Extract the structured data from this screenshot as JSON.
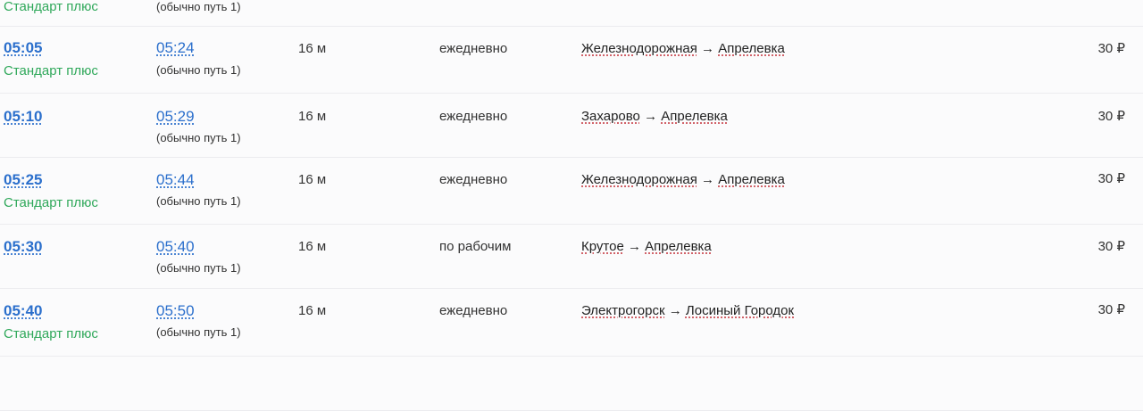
{
  "rows": [
    {
      "departure": "",
      "arrival": "",
      "type": "Стандарт плюс",
      "track": "(обычно путь 1)",
      "duration": "",
      "days": "",
      "from": "",
      "to": "",
      "arrow": "",
      "price": ""
    },
    {
      "departure": "05:05",
      "arrival": "05:24",
      "type": "Стандарт плюс",
      "track": "(обычно путь 1)",
      "duration": "16 м",
      "days": "ежедневно",
      "from": "Железнодорожная",
      "arrow": "→",
      "to": "Апрелевка",
      "price": "30 ₽"
    },
    {
      "departure": "05:10",
      "arrival": "05:29",
      "type": "",
      "track": "(обычно путь 1)",
      "duration": "16 м",
      "days": "ежедневно",
      "from": "Захарово",
      "arrow": "→",
      "to": "Апрелевка",
      "price": "30 ₽"
    },
    {
      "departure": "05:25",
      "arrival": "05:44",
      "type": "Стандарт плюс",
      "track": "(обычно путь 1)",
      "duration": "16 м",
      "days": "ежедневно",
      "from": "Железнодорожная",
      "arrow": "→",
      "to": "Апрелевка",
      "price": "30 ₽"
    },
    {
      "departure": "05:30",
      "arrival": "05:40",
      "type": "",
      "track": "(обычно путь 1)",
      "duration": "16 м",
      "days": "по рабочим",
      "from": "Крутое",
      "arrow": "→",
      "to": "Апрелевка",
      "price": "30 ₽"
    },
    {
      "departure": "05:40",
      "arrival": "05:50",
      "type": "Стандарт плюс",
      "track": "(обычно путь 1)",
      "duration": "16 м",
      "days": "ежедневно",
      "from": "Электрогорск",
      "arrow": "→",
      "to": "Лосиный Городок",
      "price": "30 ₽"
    }
  ]
}
